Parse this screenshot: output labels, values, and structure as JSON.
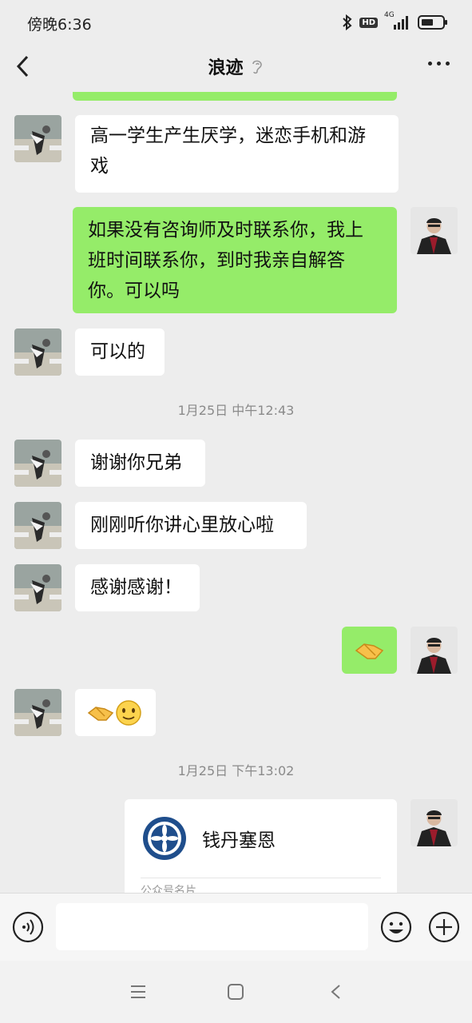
{
  "status": {
    "time": "傍晚6:36",
    "hd": "HD",
    "network": "4G"
  },
  "header": {
    "title": "浪迹"
  },
  "messages": [
    {
      "side": "left",
      "text_lines": [
        "高一学生产生厌学，迷恋手机和游",
        "戏"
      ]
    },
    {
      "side": "right",
      "text_lines": [
        "如果没有咨询师及时联系你，我上",
        "班时间联系你，到时我亲自解答",
        "你。可以吗"
      ]
    },
    {
      "side": "left",
      "text": "可以的"
    },
    {
      "time": "1月25日 中午12:43"
    },
    {
      "side": "left",
      "text": "谢谢你兄弟"
    },
    {
      "side": "left",
      "text": "刚刚听你讲心里放心啦"
    },
    {
      "side": "left",
      "text": "感谢感谢！"
    },
    {
      "side": "right",
      "emoji": "handshake"
    },
    {
      "side": "left",
      "emoji": "handshake-smile"
    },
    {
      "time": "1月25日 下午13:02"
    },
    {
      "side": "right",
      "card": {
        "name": "钱丹塞恩",
        "type": "公众号名片"
      }
    }
  ],
  "input": {
    "placeholder": ""
  },
  "colors": {
    "background": "#ededed",
    "bubble_self": "#95ec69",
    "bubble_other": "#ffffff"
  }
}
